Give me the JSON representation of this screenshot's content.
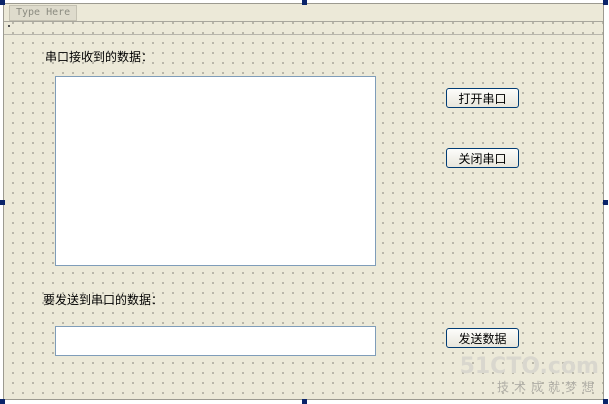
{
  "menubar": {
    "placeholder": "Type Here"
  },
  "receive": {
    "label": "串口接收到的数据："
  },
  "send": {
    "label": "要发送到串口的数据："
  },
  "buttons": {
    "open": "打开串口",
    "close": "关闭串口",
    "send": "发送数据"
  },
  "watermark": {
    "logo": "51CTO.com",
    "slogan": "技术成就梦想"
  },
  "colors": {
    "form_background": "#ece9d8",
    "button_border": "#003c74",
    "selection_handle": "#0a246a"
  }
}
